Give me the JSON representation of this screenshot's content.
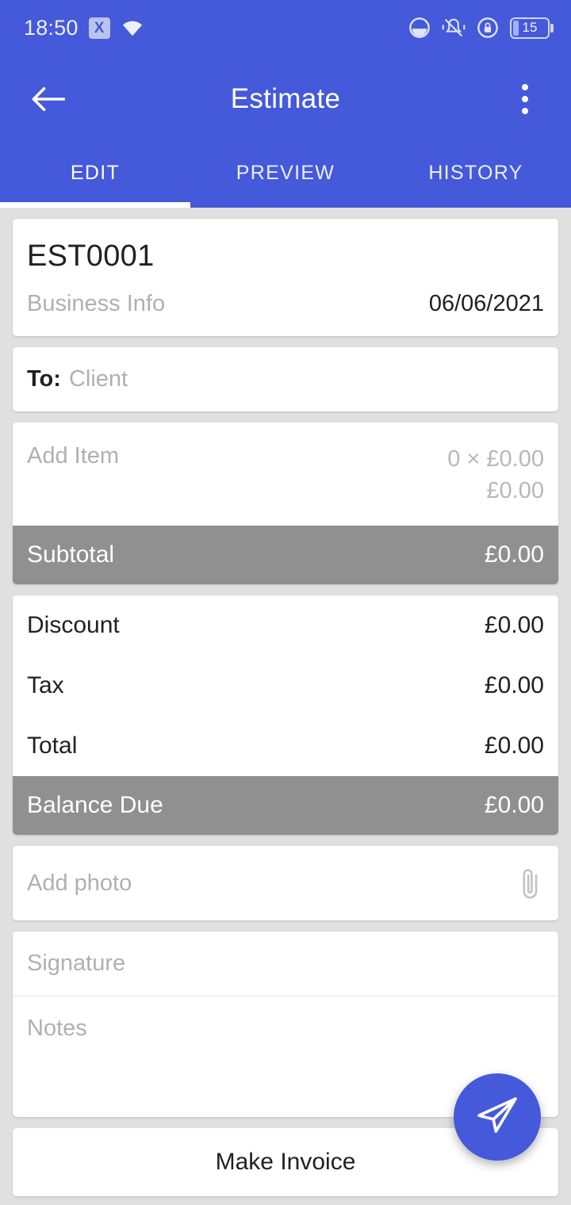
{
  "status_bar": {
    "time": "18:50",
    "sim_icon": "sim-x-icon",
    "sim_badge_text": "X",
    "wifi_icon": "wifi-icon",
    "data_saver_icon": "data-saver-icon",
    "vibrate_icon": "vibrate-bell-icon",
    "rotation_lock_icon": "rotation-lock-icon",
    "battery_icon": "battery-icon",
    "battery_level": "15"
  },
  "app_bar": {
    "back_icon": "back-arrow-icon",
    "title": "Estimate",
    "overflow_icon": "overflow-menu-icon"
  },
  "tabs": {
    "items": [
      {
        "label": "EDIT",
        "active": true
      },
      {
        "label": "PREVIEW",
        "active": false
      },
      {
        "label": "HISTORY",
        "active": false
      }
    ]
  },
  "document": {
    "number": "EST0001",
    "business_info_placeholder": "Business Info",
    "date": "06/06/2021"
  },
  "client": {
    "to_label": "To:",
    "client_placeholder": "Client"
  },
  "items": {
    "add_item_placeholder": "Add Item",
    "quantity_price": "0 × £0.00",
    "line_total": "£0.00",
    "subtotal_label": "Subtotal",
    "subtotal_value": "£0.00"
  },
  "totals": {
    "rows": [
      {
        "label": "Discount",
        "value": "£0.00"
      },
      {
        "label": "Tax",
        "value": "£0.00"
      },
      {
        "label": "Total",
        "value": "£0.00"
      }
    ],
    "balance_due_label": "Balance Due",
    "balance_due_value": "£0.00"
  },
  "attachments": {
    "add_photo_placeholder": "Add photo",
    "paperclip_icon": "paperclip-icon"
  },
  "signature": {
    "placeholder": "Signature"
  },
  "notes": {
    "placeholder": "Notes"
  },
  "actions": {
    "make_invoice_label": "Make Invoice",
    "send_fab_icon": "send-paper-plane-icon"
  },
  "colors": {
    "primary": "#4559db",
    "accent_bar": "#909090",
    "page_background": "#e0e0e0",
    "card_background": "#ffffff",
    "text_primary": "#212121",
    "text_placeholder": "#b0b0b0"
  }
}
